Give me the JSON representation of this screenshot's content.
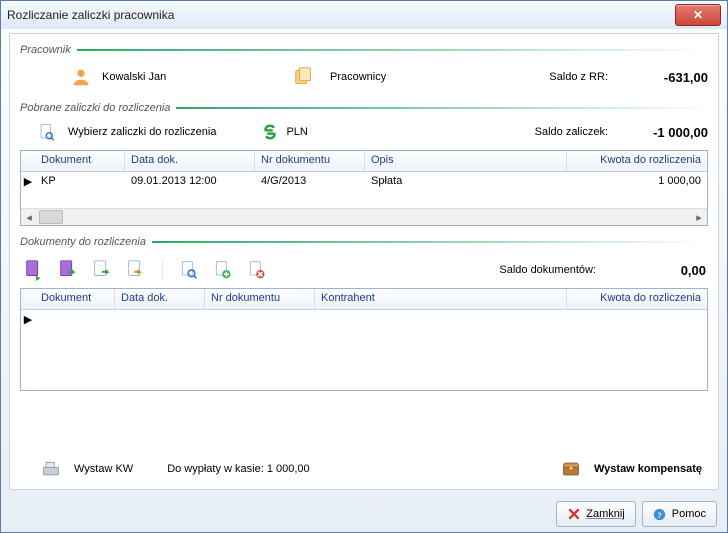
{
  "window": {
    "title": "Rozliczanie zaliczki pracownika"
  },
  "sections": {
    "employee": {
      "heading": "Pracownik"
    },
    "advances": {
      "heading": "Pobrane zaliczki do rozliczenia"
    },
    "docs": {
      "heading": "Dokumenty do rozliczenia"
    }
  },
  "employee": {
    "name": "Kowalski Jan",
    "employees_link": "Pracownicy",
    "saldo_rr_label": "Saldo z RR:",
    "saldo_rr_value": "-631,00"
  },
  "advances": {
    "choose_label": "Wybierz zaliczki do rozliczenia",
    "currency": "PLN",
    "saldo_label": "Saldo zaliczek:",
    "saldo_value": "-1 000,00",
    "columns": {
      "dokument": "Dokument",
      "data": "Data dok.",
      "nr": "Nr dokumentu",
      "opis": "Opis",
      "kwota": "Kwota do rozliczenia"
    },
    "rows": [
      {
        "dokument": "KP",
        "data": "09.01.2013 12:00",
        "nr": "4/G/2013",
        "opis": "Spłata",
        "kwota": "1 000,00"
      }
    ]
  },
  "docs": {
    "saldo_label": "Saldo dokumentów:",
    "saldo_value": "0,00",
    "columns": {
      "dokument": "Dokument",
      "data": "Data dok.",
      "nr": "Nr dokumentu",
      "kontrahent": "Kontrahent",
      "kwota": "Kwota do rozliczenia"
    }
  },
  "bottom": {
    "wystaw_kw": "Wystaw KW",
    "payout_label": "Do wypłaty w kasie: 1 000,00",
    "wystaw_komp": "Wystaw kompensatę"
  },
  "footer": {
    "close": "Zamknij",
    "help": "Pomoc"
  }
}
